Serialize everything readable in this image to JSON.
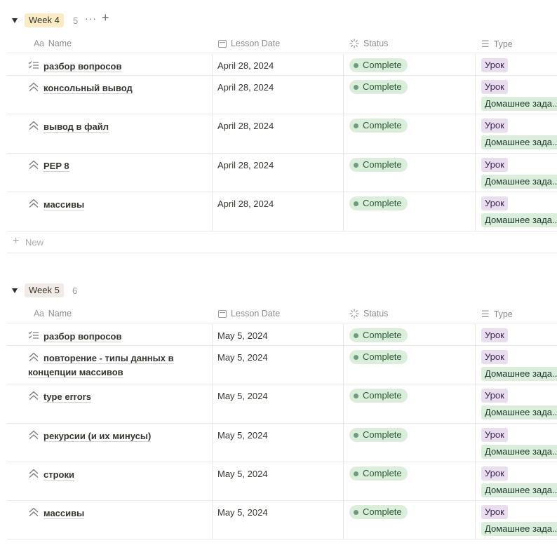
{
  "groups": [
    {
      "label": "Week 4",
      "count": "5",
      "tag_color": "#fbecc6",
      "more_label": "···",
      "add_label": "+",
      "columns": [
        "Name",
        "Lesson Date",
        "Status",
        "Type"
      ],
      "name_col_icon": "Aa",
      "rows": [
        {
          "icon": "checklist-icon",
          "name": "разбор вопросов",
          "date": "April 28, 2024",
          "status": "Complete",
          "types": [
            "Урок"
          ]
        },
        {
          "icon": "chevrons-up-icon",
          "name": "консольный вывод",
          "date": "April 28, 2024",
          "status": "Complete",
          "types": [
            "Урок",
            "Домашнее зада..."
          ]
        },
        {
          "icon": "chevrons-up-icon",
          "name": "вывод в файл",
          "date": "April 28, 2024",
          "status": "Complete",
          "types": [
            "Урок",
            "Домашнее зада..."
          ]
        },
        {
          "icon": "chevrons-up-icon",
          "name": "PEP 8",
          "date": "April 28, 2024",
          "status": "Complete",
          "types": [
            "Урок",
            "Домашнее зада..."
          ]
        },
        {
          "icon": "chevrons-up-icon",
          "name": "массивы",
          "date": "April 28, 2024",
          "status": "Complete",
          "types": [
            "Урок",
            "Домашнее зада..."
          ]
        }
      ],
      "new_label": "New"
    },
    {
      "label": "Week 5",
      "count": "6",
      "tag_color": "#f1ebe7",
      "columns": [
        "Name",
        "Lesson Date",
        "Status",
        "Type"
      ],
      "name_col_icon": "Aa",
      "rows": [
        {
          "icon": "checklist-icon",
          "name": "разбор вопросов",
          "date": "May 5, 2024",
          "status": "Complete",
          "types": [
            "Урок"
          ]
        },
        {
          "icon": "chevrons-up-icon",
          "name": "повторение - типы данных в концепции массивов",
          "date": "May 5, 2024",
          "status": "Complete",
          "types": [
            "Урок",
            "Домашнее зада..."
          ]
        },
        {
          "icon": "chevrons-up-icon",
          "name": "type errors",
          "date": "May 5, 2024",
          "status": "Complete",
          "types": [
            "Урок",
            "Домашнее зада..."
          ]
        },
        {
          "icon": "chevrons-up-icon",
          "name": "рекурсии (и их минусы)",
          "date": "May 5, 2024",
          "status": "Complete",
          "types": [
            "Урок",
            "Домашнее зада..."
          ]
        },
        {
          "icon": "chevrons-up-icon",
          "name": "строки",
          "date": "May 5, 2024",
          "status": "Complete",
          "types": [
            "Урок",
            "Домашнее зада..."
          ]
        },
        {
          "icon": "chevrons-up-icon",
          "name": "массивы",
          "date": "May 5, 2024",
          "status": "Complete",
          "types": [
            "Урок",
            "Домашнее зада..."
          ]
        }
      ]
    }
  ],
  "colors": {
    "status_bg": "#dbeddb",
    "lesson_tag_bg": "#e8deee",
    "homework_tag_bg": "#dbeddb",
    "grid_line": "#e9e9e7"
  }
}
